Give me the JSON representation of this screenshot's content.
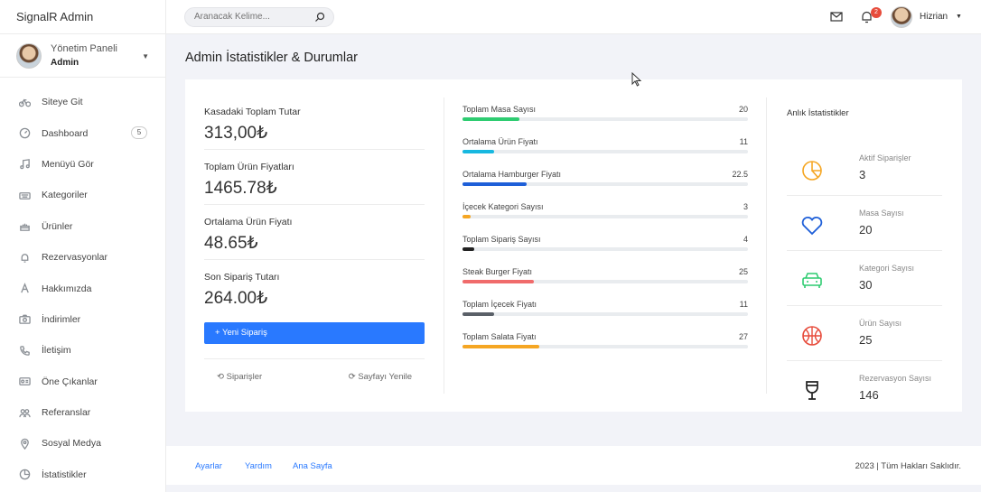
{
  "brand": "SignalR Admin",
  "profile": {
    "role": "Yönetim Paneli",
    "name": "Admin"
  },
  "sidebar": {
    "items": [
      {
        "label": "Siteye Git",
        "icon": "bicycle-icon"
      },
      {
        "label": "Dashboard",
        "icon": "gauge-icon",
        "badge": "5"
      },
      {
        "label": "Menüyü Gör",
        "icon": "music-icon"
      },
      {
        "label": "Kategoriler",
        "icon": "keyboard-icon"
      },
      {
        "label": "Ürünler",
        "icon": "cake-icon"
      },
      {
        "label": "Rezervasyonlar",
        "icon": "bell-icon"
      },
      {
        "label": "Hakkımızda",
        "icon": "font-icon"
      },
      {
        "label": "İndirimler",
        "icon": "camera-icon"
      },
      {
        "label": "İletişim",
        "icon": "phone-icon"
      },
      {
        "label": "Öne Çıkanlar",
        "icon": "id-card-icon"
      },
      {
        "label": "Referanslar",
        "icon": "users-icon"
      },
      {
        "label": "Sosyal Medya",
        "icon": "map-pin-icon"
      },
      {
        "label": "İstatistikler",
        "icon": "pie-icon"
      }
    ]
  },
  "topbar": {
    "search_placeholder": "Aranacak Kelime...",
    "notification_count": "2",
    "user_name": "Hizrian"
  },
  "page": {
    "title": "Admin İstatistikler & Durumlar"
  },
  "summary": {
    "stats": [
      {
        "label": "Kasadaki Toplam Tutar",
        "value": "313,00₺"
      },
      {
        "label": "Toplam Ürün Fiyatları",
        "value": "1465.78₺"
      },
      {
        "label": "Ortalama Ürün Fiyatı",
        "value": "48.65₺"
      },
      {
        "label": "Son Sipariş Tutarı",
        "value": "264.00₺"
      }
    ],
    "new_order_label": "+ Yeni Sipariş",
    "orders_link": "Siparişler",
    "refresh_link": "Sayfayı Yenile"
  },
  "bars": [
    {
      "label": "Toplam Masa Sayısı",
      "value": "20",
      "fill": 0.2,
      "color": "#2ecc71"
    },
    {
      "label": "Ortalama Ürün Fiyatı",
      "value": "11",
      "fill": 0.11,
      "color": "#17b8e0"
    },
    {
      "label": "Ortalama Hamburger Fiyatı",
      "value": "22.5",
      "fill": 0.225,
      "color": "#1e5fd8"
    },
    {
      "label": "İçecek Kategori Sayısı",
      "value": "3",
      "fill": 0.03,
      "color": "#f5a623"
    },
    {
      "label": "Toplam Sipariş Sayısı",
      "value": "4",
      "fill": 0.04,
      "color": "#222222"
    },
    {
      "label": "Steak Burger Fiyatı",
      "value": "25",
      "fill": 0.25,
      "color": "#f06b6b"
    },
    {
      "label": "Toplam İçecek Fiyatı",
      "value": "11",
      "fill": 0.11,
      "color": "#5a6068"
    },
    {
      "label": "Toplam Salata Fiyatı",
      "value": "27",
      "fill": 0.27,
      "color": "#f5a623"
    }
  ],
  "live": {
    "title": "Anlık İstatistikler",
    "items": [
      {
        "label": "Aktif Siparişler",
        "value": "3",
        "icon": "pie-chart-icon",
        "color": "#f5a623"
      },
      {
        "label": "Masa Sayısı",
        "value": "20",
        "icon": "heart-icon",
        "color": "#1e5fd8"
      },
      {
        "label": "Kategori Sayısı",
        "value": "30",
        "icon": "car-icon",
        "color": "#2ecc71"
      },
      {
        "label": "Ürün Sayısı",
        "value": "25",
        "icon": "basketball-icon",
        "color": "#e74c3c"
      },
      {
        "label": "Rezervasyon Sayısı",
        "value": "146",
        "icon": "wine-glass-icon",
        "color": "#222222"
      }
    ]
  },
  "footer": {
    "links": [
      "Ayarlar",
      "Yardım",
      "Ana Sayfa"
    ],
    "copyright": "2023 | Tüm Hakları Saklıdır."
  }
}
